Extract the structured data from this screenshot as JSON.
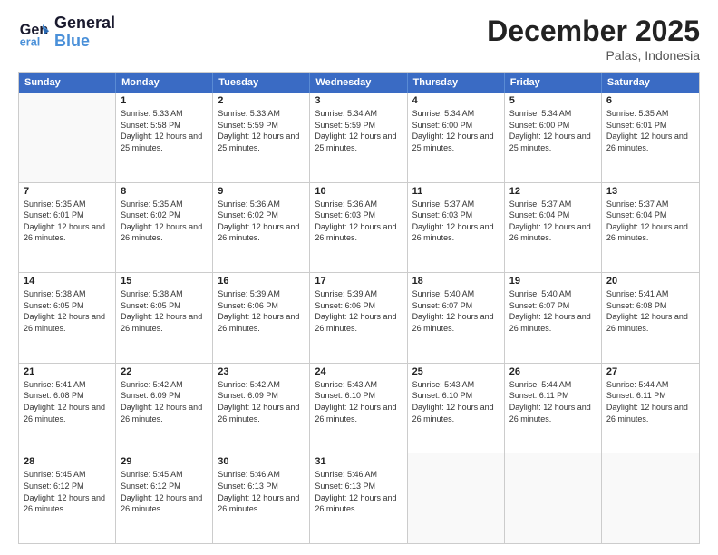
{
  "header": {
    "logo_line1": "General",
    "logo_line2": "Blue",
    "month": "December 2025",
    "location": "Palas, Indonesia"
  },
  "days_of_week": [
    "Sunday",
    "Monday",
    "Tuesday",
    "Wednesday",
    "Thursday",
    "Friday",
    "Saturday"
  ],
  "weeks": [
    [
      {
        "day": "",
        "sunrise": "",
        "sunset": "",
        "daylight": ""
      },
      {
        "day": "1",
        "sunrise": "5:33 AM",
        "sunset": "5:58 PM",
        "daylight": "12 hours and 25 minutes."
      },
      {
        "day": "2",
        "sunrise": "5:33 AM",
        "sunset": "5:59 PM",
        "daylight": "12 hours and 25 minutes."
      },
      {
        "day": "3",
        "sunrise": "5:34 AM",
        "sunset": "5:59 PM",
        "daylight": "12 hours and 25 minutes."
      },
      {
        "day": "4",
        "sunrise": "5:34 AM",
        "sunset": "6:00 PM",
        "daylight": "12 hours and 25 minutes."
      },
      {
        "day": "5",
        "sunrise": "5:34 AM",
        "sunset": "6:00 PM",
        "daylight": "12 hours and 25 minutes."
      },
      {
        "day": "6",
        "sunrise": "5:35 AM",
        "sunset": "6:01 PM",
        "daylight": "12 hours and 26 minutes."
      }
    ],
    [
      {
        "day": "7",
        "sunrise": "5:35 AM",
        "sunset": "6:01 PM",
        "daylight": "12 hours and 26 minutes."
      },
      {
        "day": "8",
        "sunrise": "5:35 AM",
        "sunset": "6:02 PM",
        "daylight": "12 hours and 26 minutes."
      },
      {
        "day": "9",
        "sunrise": "5:36 AM",
        "sunset": "6:02 PM",
        "daylight": "12 hours and 26 minutes."
      },
      {
        "day": "10",
        "sunrise": "5:36 AM",
        "sunset": "6:03 PM",
        "daylight": "12 hours and 26 minutes."
      },
      {
        "day": "11",
        "sunrise": "5:37 AM",
        "sunset": "6:03 PM",
        "daylight": "12 hours and 26 minutes."
      },
      {
        "day": "12",
        "sunrise": "5:37 AM",
        "sunset": "6:04 PM",
        "daylight": "12 hours and 26 minutes."
      },
      {
        "day": "13",
        "sunrise": "5:37 AM",
        "sunset": "6:04 PM",
        "daylight": "12 hours and 26 minutes."
      }
    ],
    [
      {
        "day": "14",
        "sunrise": "5:38 AM",
        "sunset": "6:05 PM",
        "daylight": "12 hours and 26 minutes."
      },
      {
        "day": "15",
        "sunrise": "5:38 AM",
        "sunset": "6:05 PM",
        "daylight": "12 hours and 26 minutes."
      },
      {
        "day": "16",
        "sunrise": "5:39 AM",
        "sunset": "6:06 PM",
        "daylight": "12 hours and 26 minutes."
      },
      {
        "day": "17",
        "sunrise": "5:39 AM",
        "sunset": "6:06 PM",
        "daylight": "12 hours and 26 minutes."
      },
      {
        "day": "18",
        "sunrise": "5:40 AM",
        "sunset": "6:07 PM",
        "daylight": "12 hours and 26 minutes."
      },
      {
        "day": "19",
        "sunrise": "5:40 AM",
        "sunset": "6:07 PM",
        "daylight": "12 hours and 26 minutes."
      },
      {
        "day": "20",
        "sunrise": "5:41 AM",
        "sunset": "6:08 PM",
        "daylight": "12 hours and 26 minutes."
      }
    ],
    [
      {
        "day": "21",
        "sunrise": "5:41 AM",
        "sunset": "6:08 PM",
        "daylight": "12 hours and 26 minutes."
      },
      {
        "day": "22",
        "sunrise": "5:42 AM",
        "sunset": "6:09 PM",
        "daylight": "12 hours and 26 minutes."
      },
      {
        "day": "23",
        "sunrise": "5:42 AM",
        "sunset": "6:09 PM",
        "daylight": "12 hours and 26 minutes."
      },
      {
        "day": "24",
        "sunrise": "5:43 AM",
        "sunset": "6:10 PM",
        "daylight": "12 hours and 26 minutes."
      },
      {
        "day": "25",
        "sunrise": "5:43 AM",
        "sunset": "6:10 PM",
        "daylight": "12 hours and 26 minutes."
      },
      {
        "day": "26",
        "sunrise": "5:44 AM",
        "sunset": "6:11 PM",
        "daylight": "12 hours and 26 minutes."
      },
      {
        "day": "27",
        "sunrise": "5:44 AM",
        "sunset": "6:11 PM",
        "daylight": "12 hours and 26 minutes."
      }
    ],
    [
      {
        "day": "28",
        "sunrise": "5:45 AM",
        "sunset": "6:12 PM",
        "daylight": "12 hours and 26 minutes."
      },
      {
        "day": "29",
        "sunrise": "5:45 AM",
        "sunset": "6:12 PM",
        "daylight": "12 hours and 26 minutes."
      },
      {
        "day": "30",
        "sunrise": "5:46 AM",
        "sunset": "6:13 PM",
        "daylight": "12 hours and 26 minutes."
      },
      {
        "day": "31",
        "sunrise": "5:46 AM",
        "sunset": "6:13 PM",
        "daylight": "12 hours and 26 minutes."
      },
      {
        "day": "",
        "sunrise": "",
        "sunset": "",
        "daylight": ""
      },
      {
        "day": "",
        "sunrise": "",
        "sunset": "",
        "daylight": ""
      },
      {
        "day": "",
        "sunrise": "",
        "sunset": "",
        "daylight": ""
      }
    ]
  ]
}
